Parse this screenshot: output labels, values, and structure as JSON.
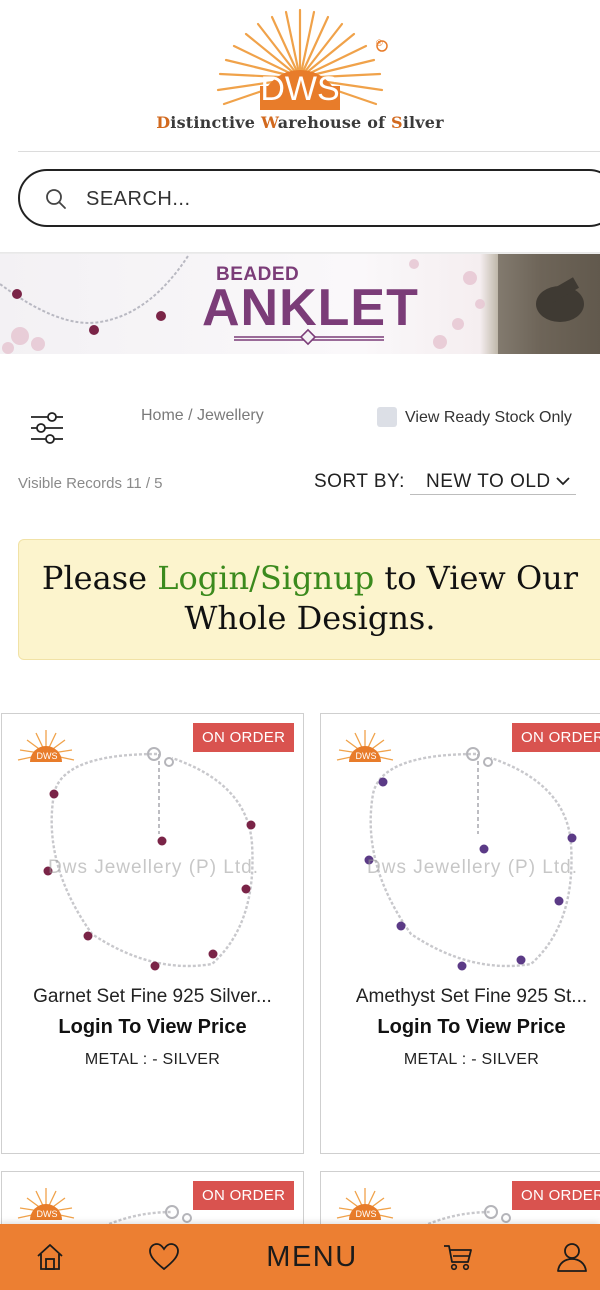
{
  "brand": {
    "logo_text": "DWS",
    "registered_mark": "®",
    "tagline_parts": [
      {
        "text": "D",
        "cap": true
      },
      {
        "text": "istinctive ",
        "cap": false
      },
      {
        "text": "W",
        "cap": true
      },
      {
        "text": "arehouse of ",
        "cap": false
      },
      {
        "text": "S",
        "cap": true
      },
      {
        "text": "ilver",
        "cap": false
      }
    ],
    "accent_color": "#ec7f32"
  },
  "search": {
    "placeholder": "SEARCH..."
  },
  "banner": {
    "title_small": "BEADED",
    "title_large": "ANKLET"
  },
  "filters": {
    "breadcrumb": "Home / Jewellery",
    "ready_stock_label": "View Ready Stock Only",
    "ready_stock_checked": false,
    "visible_records": "Visible Records 11 / 5",
    "sort_label": "SORT BY:",
    "sort_value": "NEW TO OLD"
  },
  "notice": {
    "prefix": "Please ",
    "link": "Login/Signup",
    "suffix": " to View Our Whole Designs."
  },
  "products": [
    {
      "badge": "ON ORDER",
      "name": "Garnet Set Fine 925 Silver...",
      "price": "Login To View Price",
      "metal": "METAL : - SILVER",
      "watermark": "Dws Jewellery (P) Ltd.",
      "logo": "DWS",
      "bead_color": "#7a2447"
    },
    {
      "badge": "ON ORDER",
      "name": "Amethyst Set Fine 925 St...",
      "price": "Login To View Price",
      "metal": "METAL : - SILVER",
      "watermark": "Dws Jewellery (P) Ltd.",
      "logo": "DWS",
      "bead_color": "#5b3a86"
    },
    {
      "badge": "ON ORDER",
      "logo": "DWS"
    },
    {
      "badge": "ON ORDER",
      "logo": "DWS"
    }
  ],
  "bottom_nav": {
    "home_icon": "home-icon",
    "wishlist_icon": "heart-icon",
    "menu_label": "MENU",
    "cart_icon": "cart-icon",
    "account_icon": "user-icon"
  }
}
